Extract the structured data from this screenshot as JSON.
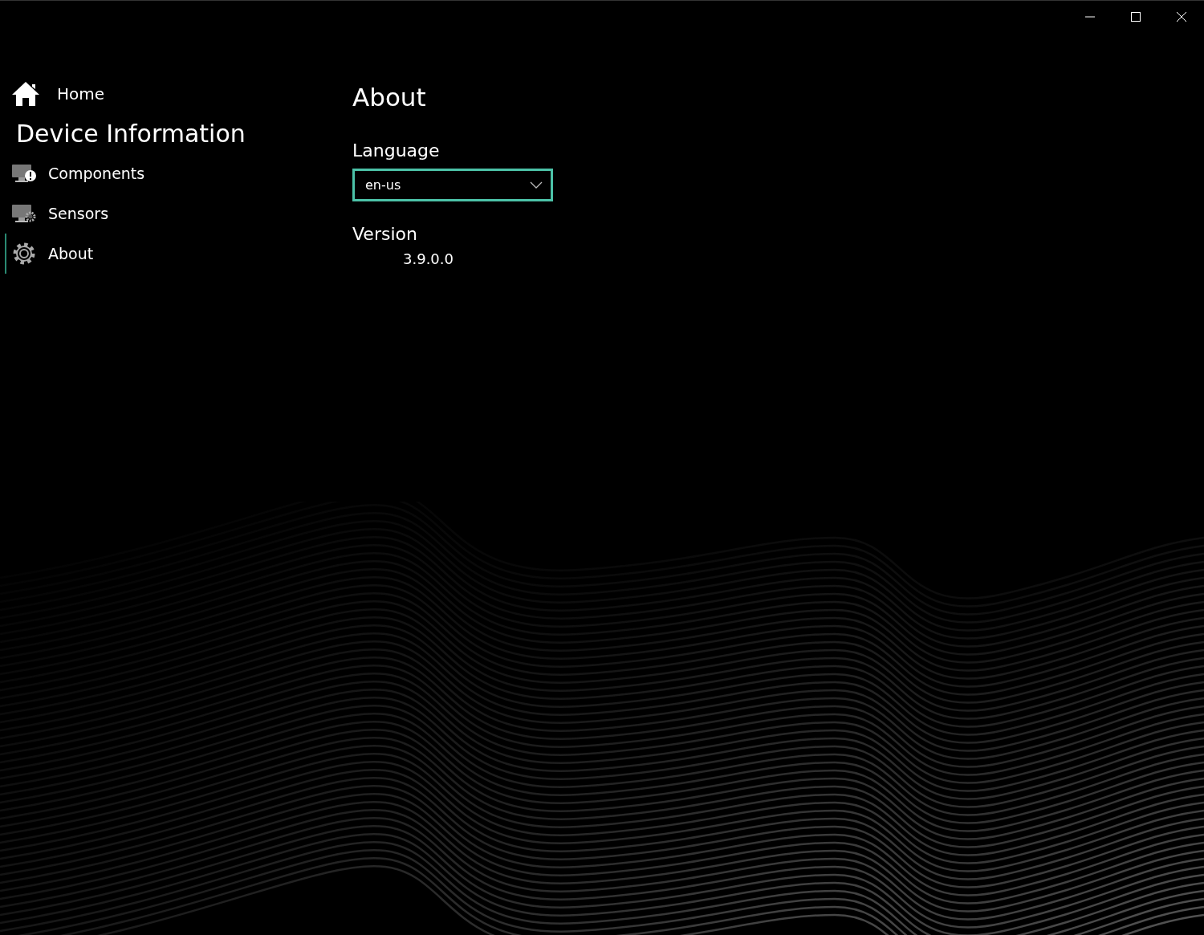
{
  "sidebar": {
    "home": {
      "label": "Home"
    },
    "title": "Device Information",
    "items": [
      {
        "kind": "components",
        "label": "Components",
        "selected": false
      },
      {
        "kind": "sensors",
        "label": "Sensors",
        "selected": false
      },
      {
        "kind": "about",
        "label": "About",
        "selected": true
      }
    ]
  },
  "page": {
    "title": "About",
    "language": {
      "label": "Language",
      "value": "en-us"
    },
    "version": {
      "label": "Version",
      "value": "3.9.0.0"
    }
  }
}
